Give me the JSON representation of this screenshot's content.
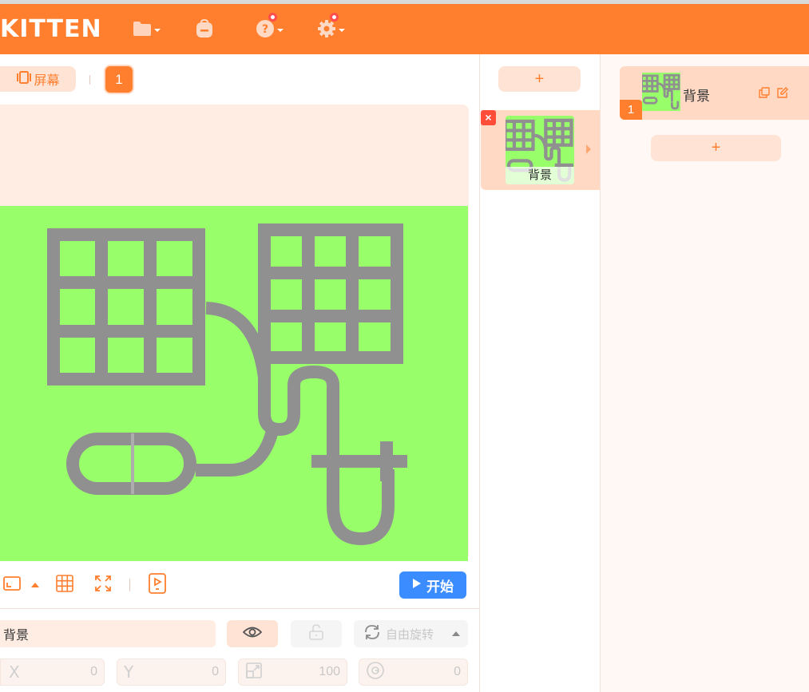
{
  "app": {
    "logo_text": "KITTEN",
    "accent_color": "#ff7f2e",
    "toolbar_icons": [
      "folder-icon",
      "backpack-icon",
      "help-icon",
      "settings-icon"
    ]
  },
  "stage": {
    "screen_label": "屏幕",
    "page_number": "1",
    "canvas_color": "#98ff6b",
    "start_label": "开始"
  },
  "properties": {
    "name_value": "背景",
    "rotation_mode": "自由旋转",
    "x_label": "X",
    "x_value": "0",
    "y_label": "Y",
    "y_value": "0",
    "scale_value": "100",
    "direction_value": "0"
  },
  "backgrounds": {
    "add_label": "+",
    "items": [
      {
        "name": "背景"
      }
    ]
  },
  "actors": {
    "add_label": "+",
    "items": [
      {
        "index": "1",
        "name": "背景"
      }
    ]
  }
}
